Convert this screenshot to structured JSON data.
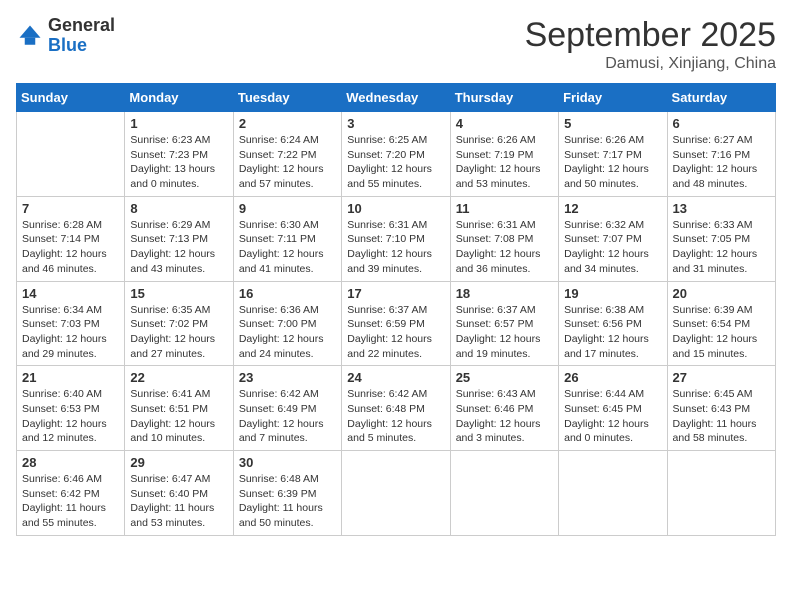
{
  "header": {
    "logo_general": "General",
    "logo_blue": "Blue",
    "month": "September 2025",
    "location": "Damusi, Xinjiang, China"
  },
  "weekdays": [
    "Sunday",
    "Monday",
    "Tuesday",
    "Wednesday",
    "Thursday",
    "Friday",
    "Saturday"
  ],
  "weeks": [
    [
      {
        "day": "",
        "sunrise": "",
        "sunset": "",
        "daylight": ""
      },
      {
        "day": "1",
        "sunrise": "Sunrise: 6:23 AM",
        "sunset": "Sunset: 7:23 PM",
        "daylight": "Daylight: 13 hours and 0 minutes."
      },
      {
        "day": "2",
        "sunrise": "Sunrise: 6:24 AM",
        "sunset": "Sunset: 7:22 PM",
        "daylight": "Daylight: 12 hours and 57 minutes."
      },
      {
        "day": "3",
        "sunrise": "Sunrise: 6:25 AM",
        "sunset": "Sunset: 7:20 PM",
        "daylight": "Daylight: 12 hours and 55 minutes."
      },
      {
        "day": "4",
        "sunrise": "Sunrise: 6:26 AM",
        "sunset": "Sunset: 7:19 PM",
        "daylight": "Daylight: 12 hours and 53 minutes."
      },
      {
        "day": "5",
        "sunrise": "Sunrise: 6:26 AM",
        "sunset": "Sunset: 7:17 PM",
        "daylight": "Daylight: 12 hours and 50 minutes."
      },
      {
        "day": "6",
        "sunrise": "Sunrise: 6:27 AM",
        "sunset": "Sunset: 7:16 PM",
        "daylight": "Daylight: 12 hours and 48 minutes."
      }
    ],
    [
      {
        "day": "7",
        "sunrise": "Sunrise: 6:28 AM",
        "sunset": "Sunset: 7:14 PM",
        "daylight": "Daylight: 12 hours and 46 minutes."
      },
      {
        "day": "8",
        "sunrise": "Sunrise: 6:29 AM",
        "sunset": "Sunset: 7:13 PM",
        "daylight": "Daylight: 12 hours and 43 minutes."
      },
      {
        "day": "9",
        "sunrise": "Sunrise: 6:30 AM",
        "sunset": "Sunset: 7:11 PM",
        "daylight": "Daylight: 12 hours and 41 minutes."
      },
      {
        "day": "10",
        "sunrise": "Sunrise: 6:31 AM",
        "sunset": "Sunset: 7:10 PM",
        "daylight": "Daylight: 12 hours and 39 minutes."
      },
      {
        "day": "11",
        "sunrise": "Sunrise: 6:31 AM",
        "sunset": "Sunset: 7:08 PM",
        "daylight": "Daylight: 12 hours and 36 minutes."
      },
      {
        "day": "12",
        "sunrise": "Sunrise: 6:32 AM",
        "sunset": "Sunset: 7:07 PM",
        "daylight": "Daylight: 12 hours and 34 minutes."
      },
      {
        "day": "13",
        "sunrise": "Sunrise: 6:33 AM",
        "sunset": "Sunset: 7:05 PM",
        "daylight": "Daylight: 12 hours and 31 minutes."
      }
    ],
    [
      {
        "day": "14",
        "sunrise": "Sunrise: 6:34 AM",
        "sunset": "Sunset: 7:03 PM",
        "daylight": "Daylight: 12 hours and 29 minutes."
      },
      {
        "day": "15",
        "sunrise": "Sunrise: 6:35 AM",
        "sunset": "Sunset: 7:02 PM",
        "daylight": "Daylight: 12 hours and 27 minutes."
      },
      {
        "day": "16",
        "sunrise": "Sunrise: 6:36 AM",
        "sunset": "Sunset: 7:00 PM",
        "daylight": "Daylight: 12 hours and 24 minutes."
      },
      {
        "day": "17",
        "sunrise": "Sunrise: 6:37 AM",
        "sunset": "Sunset: 6:59 PM",
        "daylight": "Daylight: 12 hours and 22 minutes."
      },
      {
        "day": "18",
        "sunrise": "Sunrise: 6:37 AM",
        "sunset": "Sunset: 6:57 PM",
        "daylight": "Daylight: 12 hours and 19 minutes."
      },
      {
        "day": "19",
        "sunrise": "Sunrise: 6:38 AM",
        "sunset": "Sunset: 6:56 PM",
        "daylight": "Daylight: 12 hours and 17 minutes."
      },
      {
        "day": "20",
        "sunrise": "Sunrise: 6:39 AM",
        "sunset": "Sunset: 6:54 PM",
        "daylight": "Daylight: 12 hours and 15 minutes."
      }
    ],
    [
      {
        "day": "21",
        "sunrise": "Sunrise: 6:40 AM",
        "sunset": "Sunset: 6:53 PM",
        "daylight": "Daylight: 12 hours and 12 minutes."
      },
      {
        "day": "22",
        "sunrise": "Sunrise: 6:41 AM",
        "sunset": "Sunset: 6:51 PM",
        "daylight": "Daylight: 12 hours and 10 minutes."
      },
      {
        "day": "23",
        "sunrise": "Sunrise: 6:42 AM",
        "sunset": "Sunset: 6:49 PM",
        "daylight": "Daylight: 12 hours and 7 minutes."
      },
      {
        "day": "24",
        "sunrise": "Sunrise: 6:42 AM",
        "sunset": "Sunset: 6:48 PM",
        "daylight": "Daylight: 12 hours and 5 minutes."
      },
      {
        "day": "25",
        "sunrise": "Sunrise: 6:43 AM",
        "sunset": "Sunset: 6:46 PM",
        "daylight": "Daylight: 12 hours and 3 minutes."
      },
      {
        "day": "26",
        "sunrise": "Sunrise: 6:44 AM",
        "sunset": "Sunset: 6:45 PM",
        "daylight": "Daylight: 12 hours and 0 minutes."
      },
      {
        "day": "27",
        "sunrise": "Sunrise: 6:45 AM",
        "sunset": "Sunset: 6:43 PM",
        "daylight": "Daylight: 11 hours and 58 minutes."
      }
    ],
    [
      {
        "day": "28",
        "sunrise": "Sunrise: 6:46 AM",
        "sunset": "Sunset: 6:42 PM",
        "daylight": "Daylight: 11 hours and 55 minutes."
      },
      {
        "day": "29",
        "sunrise": "Sunrise: 6:47 AM",
        "sunset": "Sunset: 6:40 PM",
        "daylight": "Daylight: 11 hours and 53 minutes."
      },
      {
        "day": "30",
        "sunrise": "Sunrise: 6:48 AM",
        "sunset": "Sunset: 6:39 PM",
        "daylight": "Daylight: 11 hours and 50 minutes."
      },
      {
        "day": "",
        "sunrise": "",
        "sunset": "",
        "daylight": ""
      },
      {
        "day": "",
        "sunrise": "",
        "sunset": "",
        "daylight": ""
      },
      {
        "day": "",
        "sunrise": "",
        "sunset": "",
        "daylight": ""
      },
      {
        "day": "",
        "sunrise": "",
        "sunset": "",
        "daylight": ""
      }
    ]
  ]
}
